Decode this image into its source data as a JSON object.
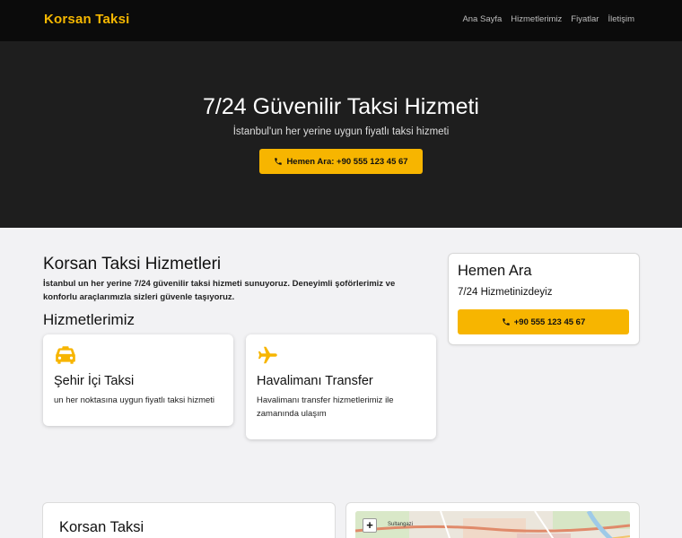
{
  "navbar": {
    "brand": "Korsan Taksi",
    "links": [
      "Ana Sayfa",
      "Hizmetlerimiz",
      "Fiyatlar",
      "İletişim"
    ]
  },
  "hero": {
    "title": "7/24 Güvenilir Taksi Hizmeti",
    "subtitle": "İstanbul'un her yerine uygun fiyatlı taksi hizmeti",
    "button_label": "Hemen Ara: +90 555 123 45 67",
    "button_icon": "phone-icon"
  },
  "main": {
    "title": "Korsan Taksi Hizmetleri",
    "description": "İstanbul un her yerine 7/24 güvenilir taksi hizmeti sunuyoruz. Deneyimli şoförlerimiz ve konforlu araçlarımızla sizleri güvenle taşıyoruz.",
    "services_title": "Hizmetlerimiz",
    "services": [
      {
        "icon": "taxi-icon",
        "title": "Şehir İçi Taksi",
        "text": "un her noktasına uygun fiyatlı taksi hizmeti"
      },
      {
        "icon": "plane-icon",
        "title": "Havalimanı Transfer",
        "text": "Havalimanı transfer hizmetlerimiz ile zamanında ulaşım"
      }
    ]
  },
  "call_box": {
    "title": "Hemen Ara",
    "subtitle": "7/24 Hizmetinizdeyiz",
    "button_label": "+90 555 123 45 67",
    "button_icon": "phone-icon"
  },
  "bottom": {
    "title": "Korsan Taksi",
    "map_label": "Sultangazi",
    "zoom_in": "+"
  },
  "colors": {
    "accent": "#f7b500",
    "navbar_bg": "#0b0b0b",
    "hero_bg": "#1e1e1e",
    "page_bg": "#f2f2f4"
  }
}
